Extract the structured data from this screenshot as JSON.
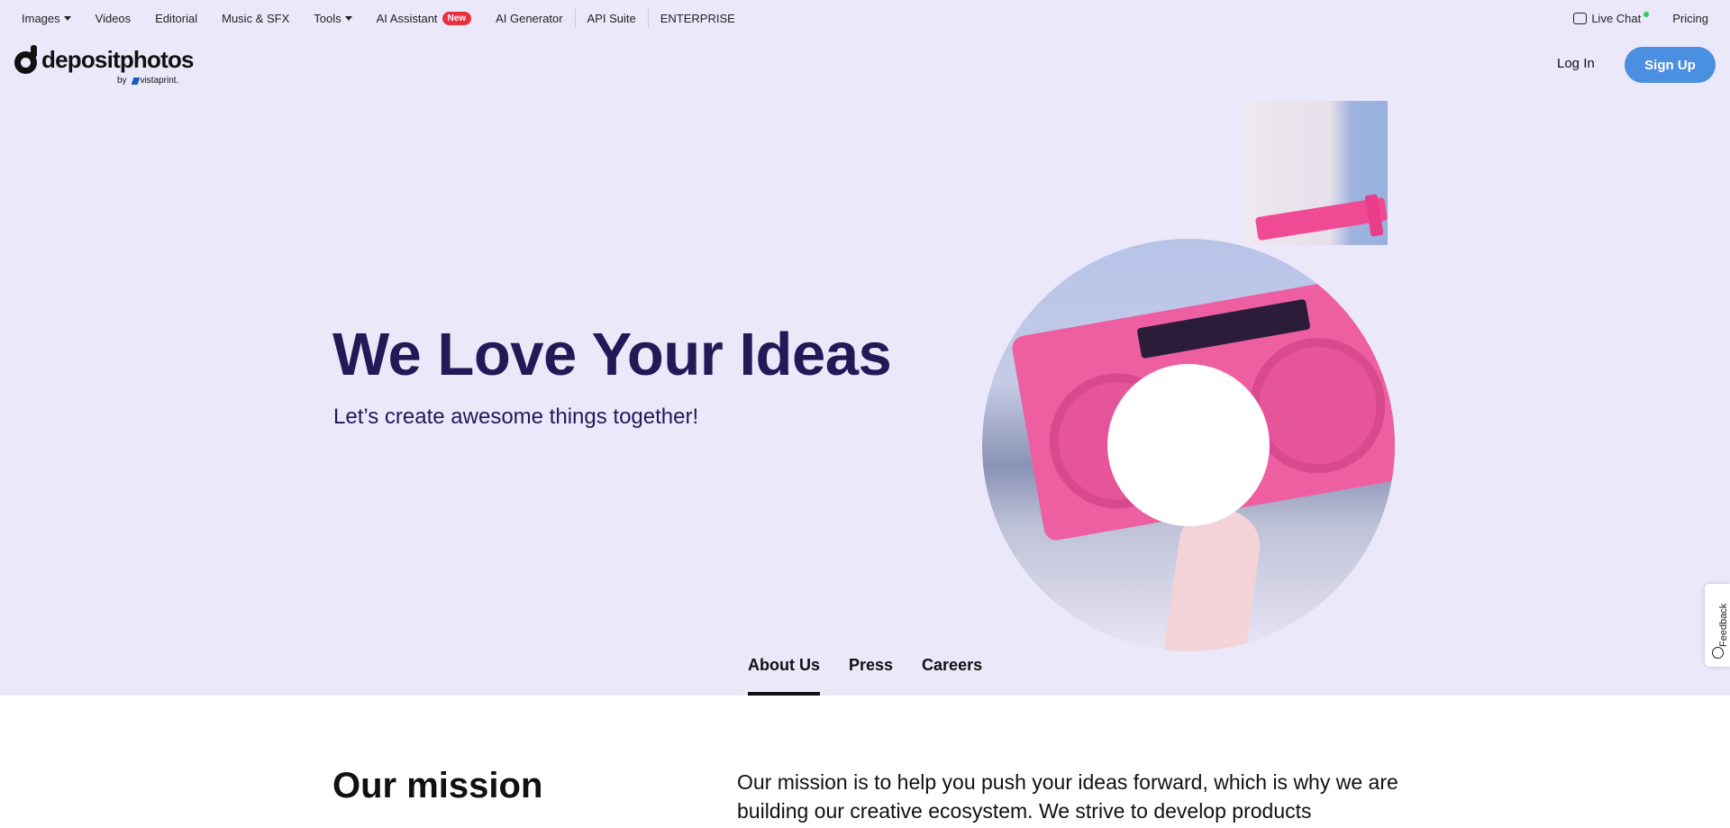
{
  "nav": {
    "items": [
      {
        "label": "Images",
        "dropdown": true
      },
      {
        "label": "Videos",
        "dropdown": false
      },
      {
        "label": "Editorial",
        "dropdown": false
      },
      {
        "label": "Music & SFX",
        "dropdown": false
      },
      {
        "label": "Tools",
        "dropdown": true
      },
      {
        "label": "AI Assistant",
        "dropdown": false
      },
      {
        "label": "AI Generator",
        "dropdown": false
      },
      {
        "label": "API Suite",
        "dropdown": false
      },
      {
        "label": "ENTERPRISE",
        "dropdown": false
      }
    ],
    "ai_badge": "New",
    "live_chat": "Live Chat",
    "pricing": "Pricing"
  },
  "header": {
    "logo_text": "depositphotos",
    "logo_by": "by",
    "logo_partner": "vistaprint.",
    "login": "Log In",
    "signup": "Sign Up"
  },
  "hero": {
    "title": "We Love Your Ideas",
    "subtitle": "Let’s create awesome things together!"
  },
  "tabs": {
    "items": [
      "About Us",
      "Press",
      "Careers"
    ],
    "active": "About Us"
  },
  "feedback": {
    "label": "Feedback"
  },
  "mission": {
    "title": "Our mission",
    "text": "Our mission is to help you push your ideas forward, which is why we are building our creative ecosystem. We strive to develop products"
  },
  "colors": {
    "hero_bg": "#ebe8fa",
    "title_color": "#231957",
    "signup_bg": "#4a8fe0",
    "badge_red": "#e8303f",
    "live_dot": "#2ec866"
  }
}
